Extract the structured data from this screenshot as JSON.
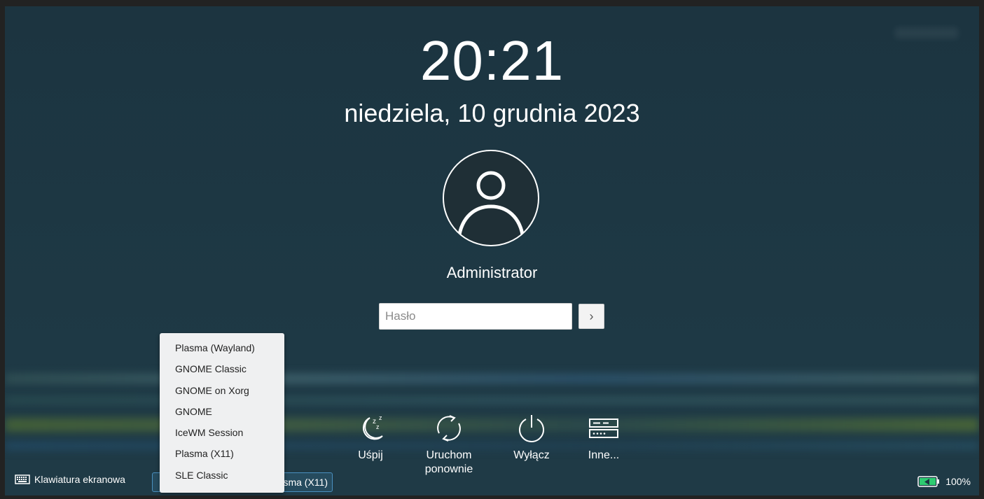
{
  "clock": {
    "time": "20:21",
    "date": "niedziela, 10 grudnia 2023"
  },
  "user": {
    "name": "Administrator"
  },
  "login": {
    "password_placeholder": "Hasło",
    "submit_glyph": "›"
  },
  "actions": [
    {
      "label": "Uśpij",
      "icon": "sleep-icon"
    },
    {
      "label": "Uruchom ponownie",
      "icon": "restart-icon"
    },
    {
      "label": "Wyłącz",
      "icon": "power-icon"
    },
    {
      "label": "Inne...",
      "icon": "other-sessions-icon"
    }
  ],
  "footer": {
    "virtual_keyboard_label": "Klawiatura ekranowa",
    "session_selected": "Plasma (X11)",
    "battery_percent": "100%"
  },
  "session_menu": {
    "options": [
      "Plasma (Wayland)",
      "GNOME Classic",
      "GNOME on Xorg",
      "GNOME",
      "IceWM Session",
      "Plasma (X11)",
      "SLE Classic"
    ]
  },
  "colors": {
    "background": "#1d3743",
    "menu_bg": "#eff0f1",
    "accent": "#4a90c0"
  }
}
